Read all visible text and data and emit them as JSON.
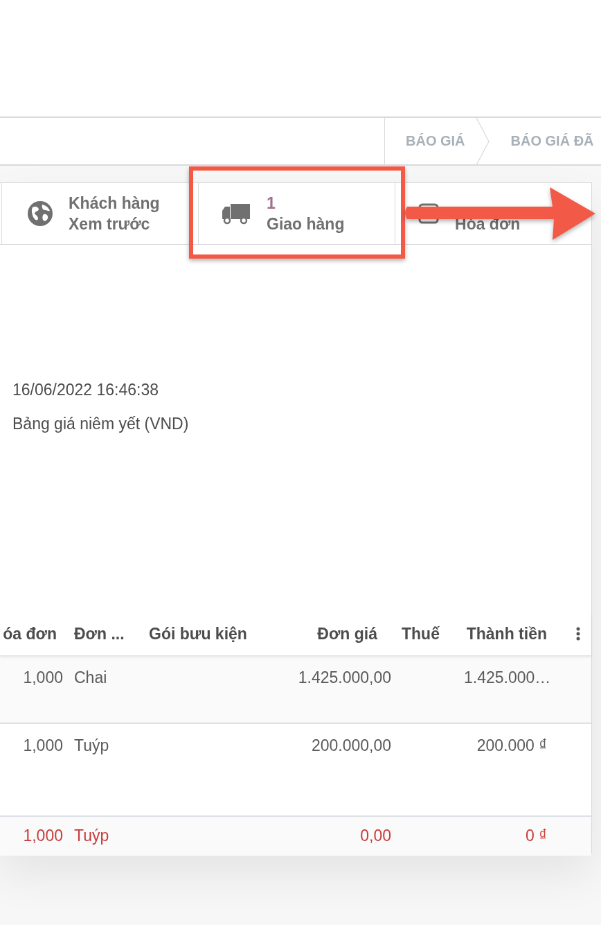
{
  "breadcrumbs": [
    {
      "label": "BÁO GIÁ"
    },
    {
      "label": "BÁO GIÁ ĐÃ"
    }
  ],
  "smart_buttons": [
    {
      "kind": "text",
      "lines": [
        "Khách hàng",
        "Xem trước"
      ]
    },
    {
      "kind": "stat",
      "count": "1",
      "label": "Giao hàng"
    },
    {
      "kind": "stat",
      "label": "Hóa đơn"
    }
  ],
  "fields": [
    {
      "value": "16/06/2022 16:46:38"
    },
    {
      "value": "Bảng giá niêm yết (VND)"
    }
  ],
  "table": {
    "columns": [
      "óa đơn",
      "Đơn ...",
      "Gói bưu kiện",
      "Đơn giá",
      "Thuế",
      "Thành tiền"
    ],
    "rows": [
      {
        "qty": "1,000",
        "unit": "Chai",
        "unit_price": "1.425.000,00",
        "subtotal": "1.425.000…",
        "warning": false
      },
      {
        "qty": "1,000",
        "unit": "Tuýp",
        "unit_price": "200.000,00",
        "subtotal": "200.000 ₫",
        "warning": false
      },
      {
        "qty": "1,000",
        "unit": "Tuýp",
        "unit_price": "0,00",
        "subtotal": "0 ₫",
        "warning": true
      }
    ]
  }
}
